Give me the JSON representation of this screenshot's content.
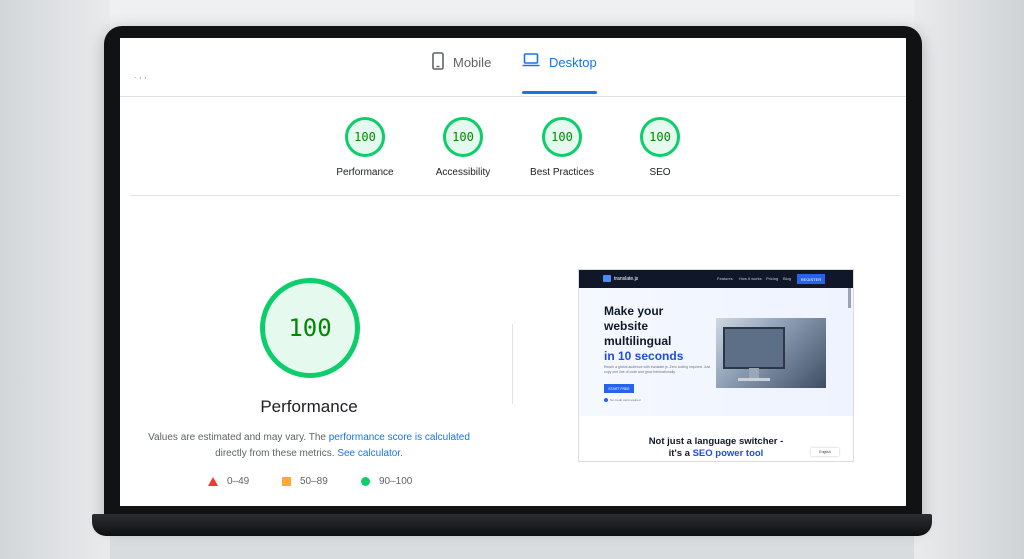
{
  "tabs": {
    "mobile_label": "Mobile",
    "desktop_label": "Desktop",
    "active": "Desktop"
  },
  "gauges": [
    {
      "score": "100",
      "label": "Performance"
    },
    {
      "score": "100",
      "label": "Accessibility"
    },
    {
      "score": "100",
      "label": "Best Practices"
    },
    {
      "score": "100",
      "label": "SEO"
    }
  ],
  "performance": {
    "score": "100",
    "title": "Performance",
    "desc_prefix": "Values are estimated and may vary. The ",
    "score_link": "performance score is calculated",
    "desc_middle": " directly from these metrics. ",
    "calculator_link": "See calculator."
  },
  "legend": [
    {
      "range": "0–49",
      "color": "#ff3333"
    },
    {
      "range": "50–89",
      "color": "#ffaa33"
    },
    {
      "range": "90–100",
      "color": "#0cce6b"
    }
  ],
  "thumbnail": {
    "logo": "translate.js",
    "nav": [
      "Features",
      "How it works",
      "Pricing",
      "Blog"
    ],
    "register": "REGISTER",
    "headline_1": "Make your",
    "headline_2": "website",
    "headline_3": "multilingual",
    "headline_4": "in 10 seconds",
    "subtext": "Reach a global audience with translate.js. Zero coding required. Just copy one line of code and grow internationally.",
    "start_button": "START FREE",
    "note": "No credit card required",
    "section_title_1": "Not just a language switcher -",
    "section_title_2": "it's a",
    "section_title_3": "SEO power tool",
    "switcher": "English"
  },
  "colors": {
    "pass_green": "#0cce6b",
    "accent_blue": "#1a73e8"
  }
}
